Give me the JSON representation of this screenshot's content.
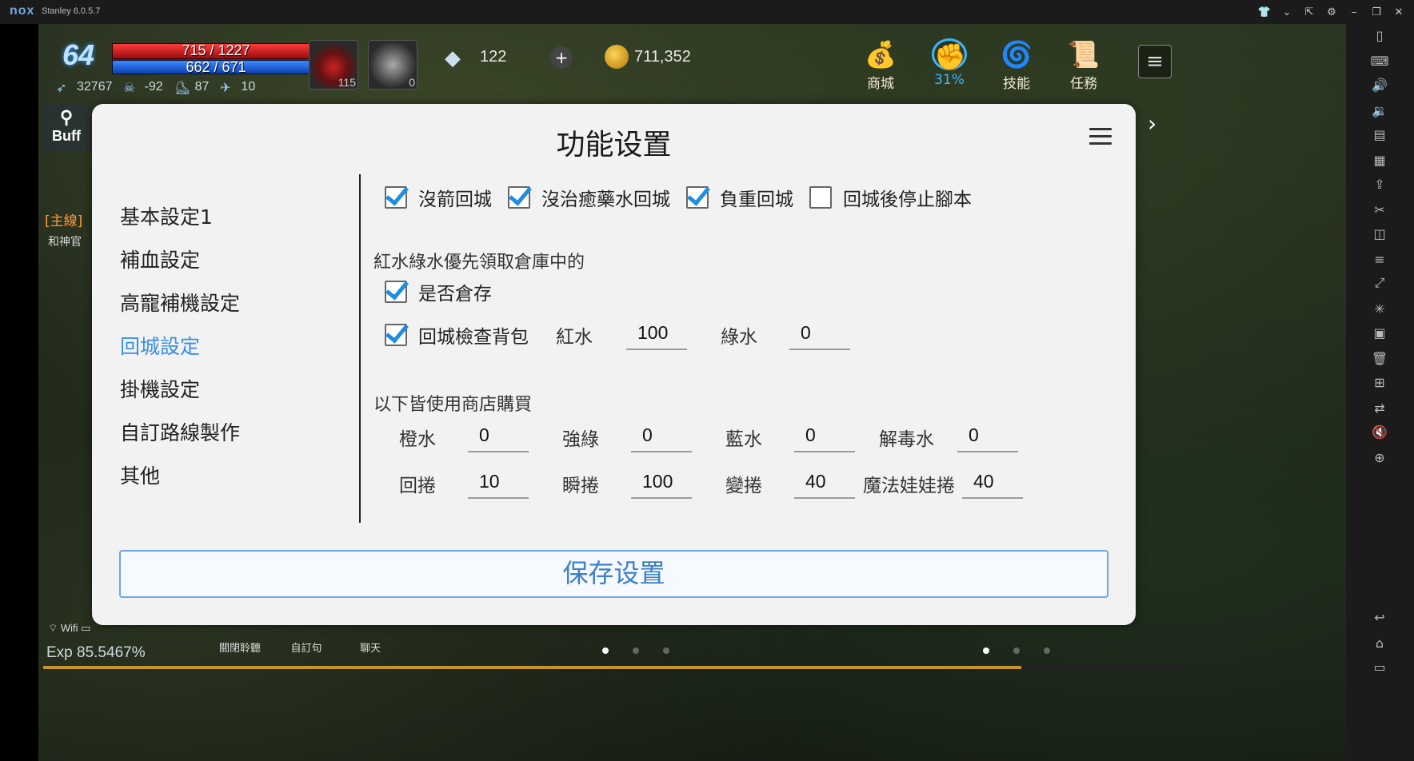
{
  "emulator": {
    "logo": "nox",
    "title": "Stanley 6.0.5.7"
  },
  "hud": {
    "level": "64",
    "hp": "715 / 1227",
    "mp": "662 / 671",
    "stat_power": "32767",
    "stat_karma": "-92",
    "stat_weight": "87",
    "stat_speed": "10",
    "potion_count": "115",
    "leaf_count": "0",
    "gem_count": "122",
    "gold_count": "711,352",
    "menu_shop": "商城",
    "menu_percent": "31%",
    "menu_skill": "技能",
    "menu_quest": "任務",
    "buff_label": "Buff",
    "quest_tag": "[主線]",
    "quest_sub": "和神官",
    "wifi_label": "Wifi",
    "exp": "Exp 85.5467%",
    "btn_toggle_chat": "關閉聆聽",
    "btn_custom": "自訂句",
    "btn_chat": "聊天",
    "exp_progress": 0.855
  },
  "dialog": {
    "title": "功能设置",
    "nav": [
      {
        "label": "基本設定1",
        "active": false
      },
      {
        "label": "補血設定",
        "active": false
      },
      {
        "label": "高寵補機設定",
        "active": false
      },
      {
        "label": "回城設定",
        "active": true
      },
      {
        "label": "掛機設定",
        "active": false
      },
      {
        "label": "自訂路線製作",
        "active": false
      },
      {
        "label": "其他",
        "active": false
      }
    ],
    "top_checks": [
      {
        "label": "沒箭回城",
        "checked": true
      },
      {
        "label": "沒治癒藥水回城",
        "checked": true
      },
      {
        "label": "負重回城",
        "checked": true
      },
      {
        "label": "回城後停止腳本",
        "checked": false
      }
    ],
    "warehouse_section": "紅水綠水優先領取倉庫中的",
    "check_warehouse": {
      "label": "是否倉存",
      "checked": true
    },
    "check_bag": {
      "label": "回城檢查背包",
      "checked": true
    },
    "red_label": "紅水",
    "red_value": "100",
    "green_label": "綠水",
    "green_value": "0",
    "shop_section": "以下皆使用商店購買",
    "shop_row1": [
      {
        "label": "橙水",
        "value": "0"
      },
      {
        "label": "強綠",
        "value": "0"
      },
      {
        "label": "藍水",
        "value": "0"
      },
      {
        "label": "解毒水",
        "value": "0"
      }
    ],
    "shop_row2": [
      {
        "label": "回捲",
        "value": "10"
      },
      {
        "label": "瞬捲",
        "value": "100"
      },
      {
        "label": "變捲",
        "value": "40"
      },
      {
        "label": "魔法娃娃捲",
        "value": "40"
      }
    ],
    "save_button": "保存设置"
  },
  "colors": {
    "accent": "#3a8ee6",
    "check": "#1f8ee0",
    "dialog_bg": "#f2f2f2"
  }
}
